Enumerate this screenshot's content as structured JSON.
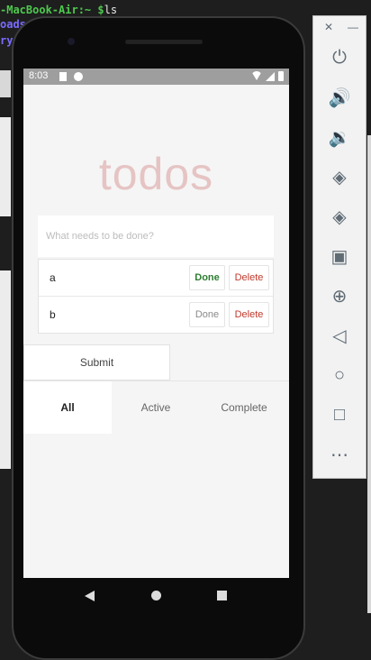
{
  "terminal": {
    "line1_prompt": "-MacBook-Air:~ $",
    "line1_cmd": "ls",
    "line2": "oads",
    "line3": "ry"
  },
  "status_bar": {
    "time": "8:03"
  },
  "app": {
    "title": "todos",
    "input_placeholder": "What needs to be done?",
    "todos": [
      {
        "text": "a",
        "done_label": "Done",
        "delete_label": "Delete",
        "completed": true
      },
      {
        "text": "b",
        "done_label": "Done",
        "delete_label": "Delete",
        "completed": false
      }
    ],
    "submit_label": "Submit",
    "tabs": [
      {
        "label": "All",
        "selected": true
      },
      {
        "label": "Active",
        "selected": false
      },
      {
        "label": "Complete",
        "selected": false
      }
    ]
  },
  "emulator_toolbar": {
    "items": [
      "close-icon",
      "minimize-icon",
      "power-icon",
      "volume-up-icon",
      "volume-down-icon",
      "rotate-left-icon",
      "rotate-right-icon",
      "camera-icon",
      "zoom-icon",
      "back-icon",
      "home-icon",
      "overview-icon",
      "more-icon"
    ]
  }
}
